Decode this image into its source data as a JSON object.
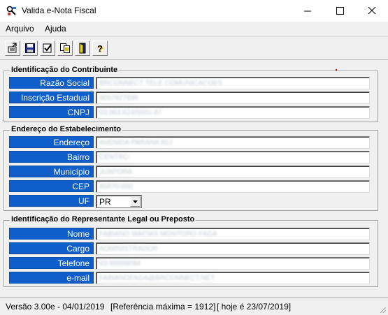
{
  "window": {
    "title": "Valida e-Nota Fiscal",
    "minimize_glyph": "—",
    "maximize_glyph": "☐",
    "close_glyph": "✕"
  },
  "menu": {
    "items": [
      "Arquivo",
      "Ajuda"
    ]
  },
  "toolbar": {
    "buttons": [
      {
        "icon": "export-icon"
      },
      {
        "icon": "save-icon"
      },
      {
        "icon": "check-icon"
      },
      {
        "icon": "copy-icon"
      },
      {
        "icon": "exit-door-icon"
      },
      {
        "icon": "help-icon",
        "glyph": "?"
      }
    ]
  },
  "contribuinte": {
    "title": "Identificação do Contribuinte",
    "fields": [
      {
        "label": "Razão Social",
        "value": "BRCONNECT TELE COMUNICACOES"
      },
      {
        "label": "Inscrição Estadual",
        "value": "9057827896"
      },
      {
        "label": "CNPJ",
        "value": "03.963.624/0001-87"
      }
    ]
  },
  "estabelecimento": {
    "title": "Endereço do Estabelecimento",
    "fields": [
      {
        "label": "Endereço",
        "value": "AVENIDA PARANA 812"
      },
      {
        "label": "Bairro",
        "value": "CENTRO"
      },
      {
        "label": "Município",
        "value": "JUAPORA"
      },
      {
        "label": "CEP",
        "value": "86870-000"
      }
    ],
    "uf": {
      "label": "UF",
      "value": "PR"
    }
  },
  "representante": {
    "title": "Identificação do Representante Legal ou Preposto",
    "fields": [
      {
        "label": "Nome",
        "value": "FABIANO MACIAS MONTORO FAGA"
      },
      {
        "label": "Cargo",
        "value": "ADMINISTRADOR"
      },
      {
        "label": "Telefone",
        "value": "43-99999094"
      },
      {
        "label": "e-mail",
        "value": "FABIANOFAGA@BRCONNECT.NET"
      }
    ]
  },
  "status": {
    "version": "Versão 3.00e - 04/01/2019",
    "reference": "[Referência máxima = 1912]",
    "today": "[ hoje é 23/07/2019]"
  },
  "colors": {
    "label_bg": "#0f5ec9",
    "accent_red": "#e00000"
  }
}
